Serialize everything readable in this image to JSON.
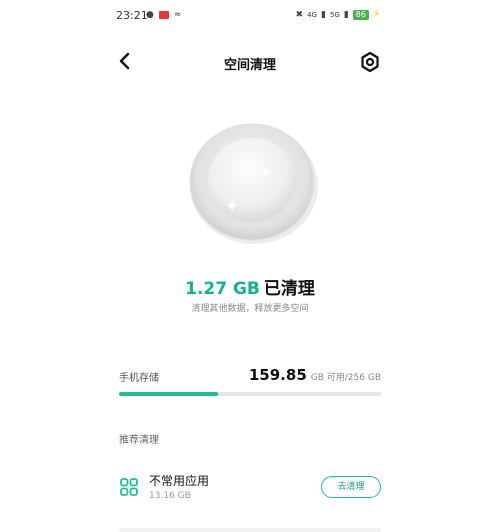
{
  "status_bar": {
    "time": "23:21",
    "left_icons": [
      "weibo-icon",
      "app-badge-icon",
      "nfc-icon"
    ],
    "network_1": "4G",
    "network_2": "5G",
    "battery": "86"
  },
  "header": {
    "title": "空间清理",
    "back_icon": "chevron-left-icon",
    "settings_icon": "hexagon-settings-icon"
  },
  "result": {
    "value": "1.27 GB",
    "label": "已清理",
    "subtitle": "清理其他数据，释放更多空间"
  },
  "storage": {
    "label": "手机存储",
    "available": "159.85",
    "unit_text": "GB 可用/256 GB",
    "used_fraction": 0.376
  },
  "recommend": {
    "title": "推荐清理",
    "items": [
      {
        "name": "不常用应用",
        "size": "13.16 GB",
        "button": "去清理",
        "icon": "apps-grid-icon"
      }
    ]
  },
  "colors": {
    "accent": "#1fbf94",
    "accent_text": "#12b38a"
  }
}
